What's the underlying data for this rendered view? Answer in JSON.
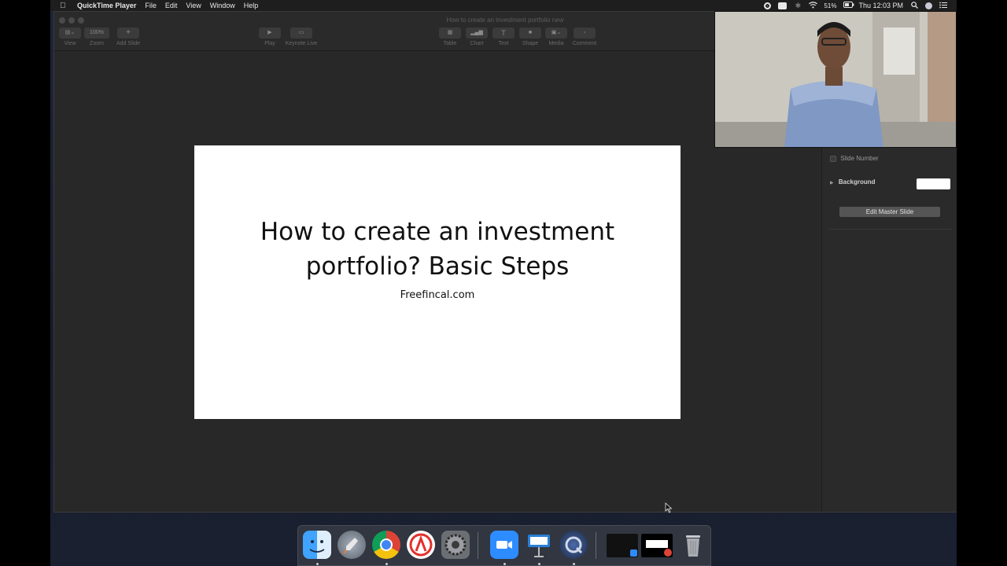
{
  "menubar": {
    "app_name": "QuickTime Player",
    "menus": [
      "File",
      "Edit",
      "View",
      "Window",
      "Help"
    ],
    "battery": "51%",
    "clock": "Thu 12:03 PM"
  },
  "window": {
    "title": "How to create an investment portfolio new"
  },
  "toolbar": {
    "view_label": "View",
    "zoom_value": "100%",
    "zoom_label": "Zoom",
    "add_slide_label": "Add Slide",
    "play_label": "Play",
    "keynote_live_label": "Keynote Live",
    "table_label": "Table",
    "chart_label": "Chart",
    "text_label": "Text",
    "shape_label": "Shape",
    "media_label": "Media",
    "comment_label": "Comment"
  },
  "slide": {
    "title_line1": "How to create an investment",
    "title_line2": "portfolio? Basic Steps",
    "subtitle": "Freefincal.com"
  },
  "inspector": {
    "slide_number_label": "Slide Number",
    "background_label": "Background",
    "background_color": "#ffffff",
    "edit_master_label": "Edit Master Slide"
  },
  "dock": {
    "apps": [
      "finder-icon",
      "launchpad-icon",
      "chrome-icon",
      "autodesk-icon",
      "system-preferences-icon",
      "zoom-icon",
      "keynote-icon",
      "quicktime-icon",
      "trash-icon"
    ]
  }
}
